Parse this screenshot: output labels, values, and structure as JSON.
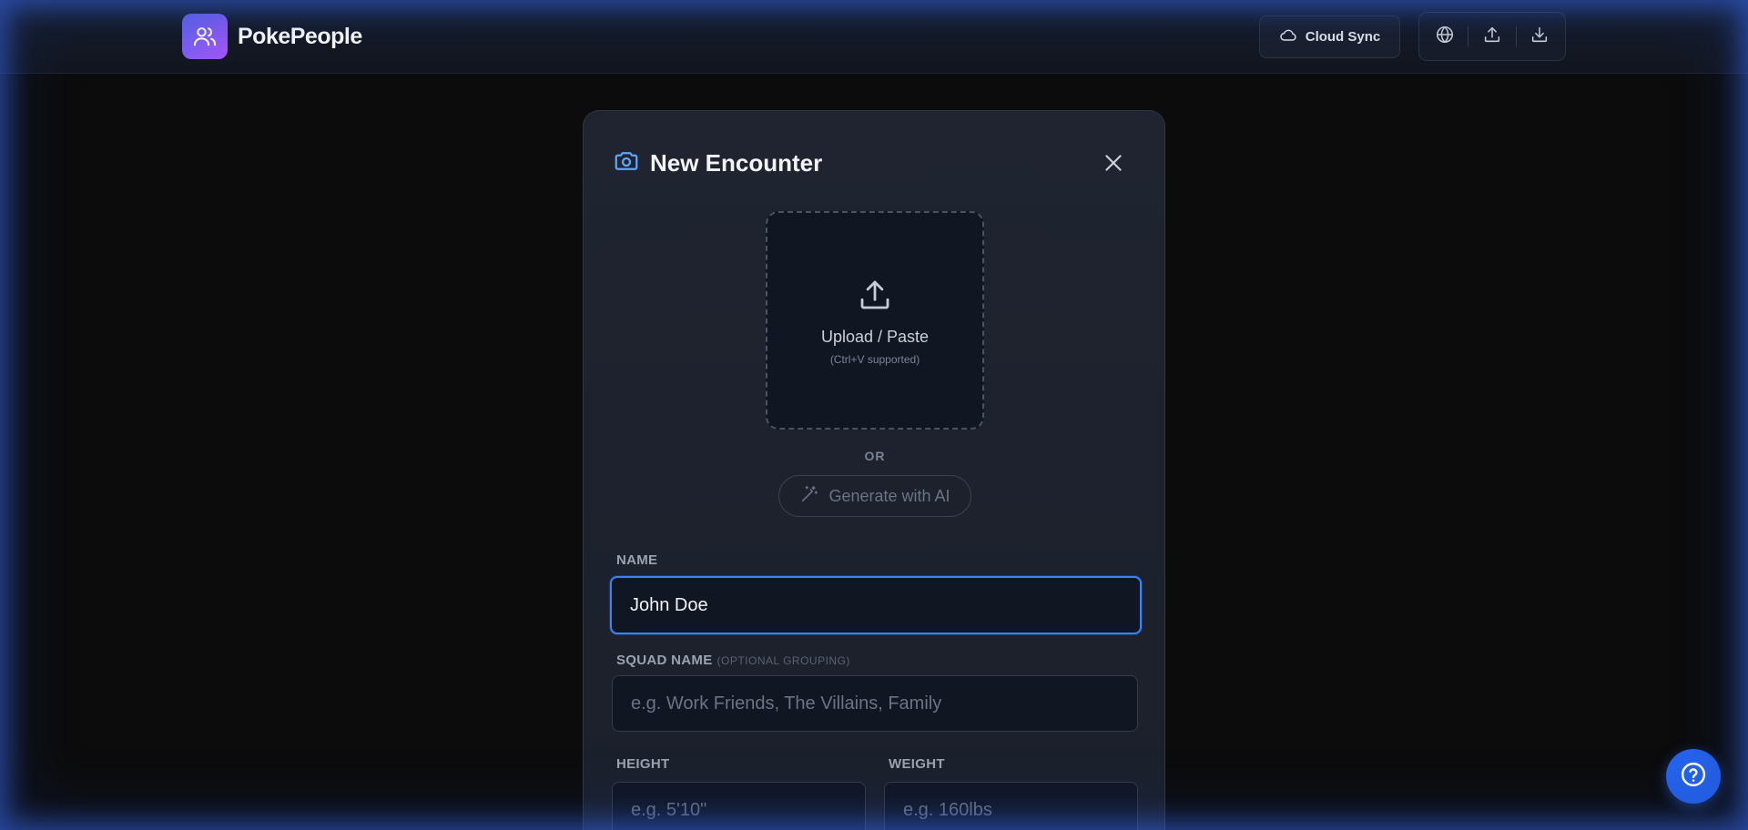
{
  "header": {
    "brand_name": "PokePeople",
    "brand_icon": "users-icon",
    "cloud_sync_label": "Cloud Sync",
    "tools": [
      "globe-icon",
      "upload-icon",
      "download-icon"
    ]
  },
  "modal": {
    "title": "New Encounter",
    "title_icon": "camera-icon",
    "upload": {
      "label": "Upload / Paste",
      "hint": "(Ctrl+V supported)"
    },
    "or_text": "OR",
    "generate_label": "Generate with AI",
    "fields": {
      "name": {
        "label": "NAME",
        "value": "John Doe"
      },
      "squad": {
        "label": "SQUAD NAME",
        "note": "(OPTIONAL GROUPING)",
        "placeholder": "e.g. Work Friends, The Villains, Family"
      },
      "height": {
        "label": "HEIGHT",
        "placeholder": "e.g. 5'10\""
      },
      "weight": {
        "label": "WEIGHT",
        "placeholder": "e.g. 160lbs"
      }
    }
  },
  "colors": {
    "accent": "#3b82f6",
    "brand_gradient_start": "#6366f1",
    "brand_gradient_end": "#a855f7",
    "help_fab": "#2563eb"
  }
}
